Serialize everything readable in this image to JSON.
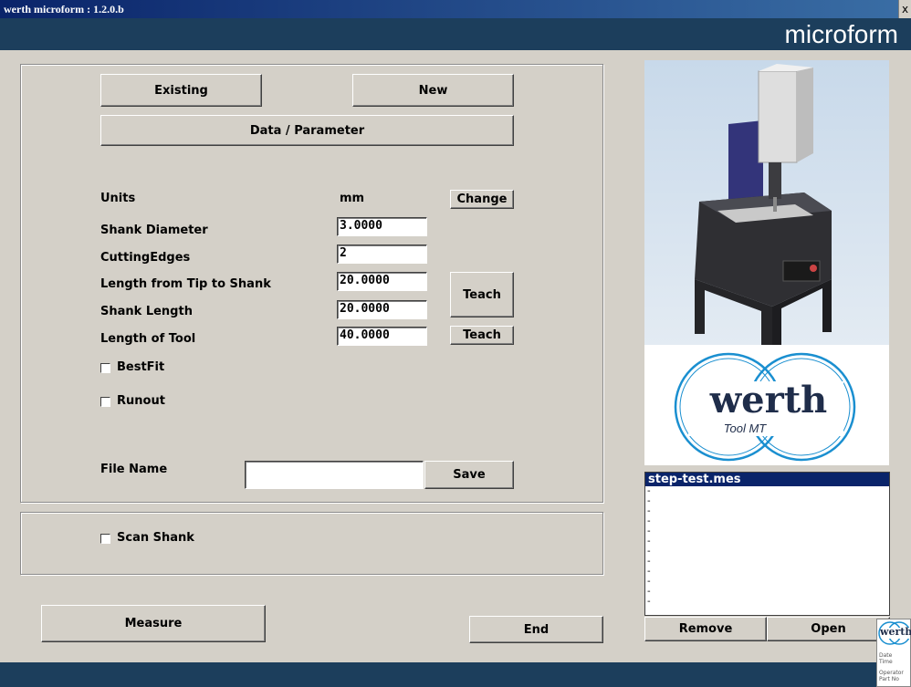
{
  "window": {
    "title": "werth microform : 1.2.0.b",
    "close_glyph": "x"
  },
  "brand": "microform",
  "buttons": {
    "existing": "Existing",
    "new": "New",
    "data_parameter": "Data / Parameter",
    "change": "Change",
    "teach1": "Teach",
    "teach2": "Teach",
    "save": "Save",
    "measure": "Measure",
    "end": "End",
    "remove": "Remove",
    "open": "Open"
  },
  "units": {
    "label": "Units",
    "value": "mm"
  },
  "fields": [
    {
      "label": "Shank Diameter",
      "value": "3.0000"
    },
    {
      "label": "CuttingEdges",
      "value": "2"
    },
    {
      "label": "Length from Tip to Shank",
      "value": "20.0000"
    },
    {
      "label": "Shank Length",
      "value": "20.0000"
    },
    {
      "label": "Length of Tool",
      "value": "40.0000"
    }
  ],
  "checkboxes": {
    "bestfit": "BestFit",
    "runout": "Runout",
    "scan_shank": "Scan Shank"
  },
  "file_name": {
    "label": "File Name",
    "value": ""
  },
  "file_list": {
    "selected": "step-test.mes",
    "items": [
      "-",
      "-",
      "-",
      "-",
      "-",
      "-",
      "-",
      "-",
      "-",
      "-",
      "-",
      "-"
    ]
  },
  "logo": {
    "name": "werth",
    "sub": "Tool MT"
  },
  "mini_card": {
    "name": "werth",
    "lines": [
      "Date",
      "Time",
      "Operator",
      "Part No"
    ]
  },
  "colors": {
    "header": "#1c3e5c",
    "selection": "#0a246a",
    "logo_blue": "#1a8fd0",
    "machine_blue": "#33347a"
  }
}
